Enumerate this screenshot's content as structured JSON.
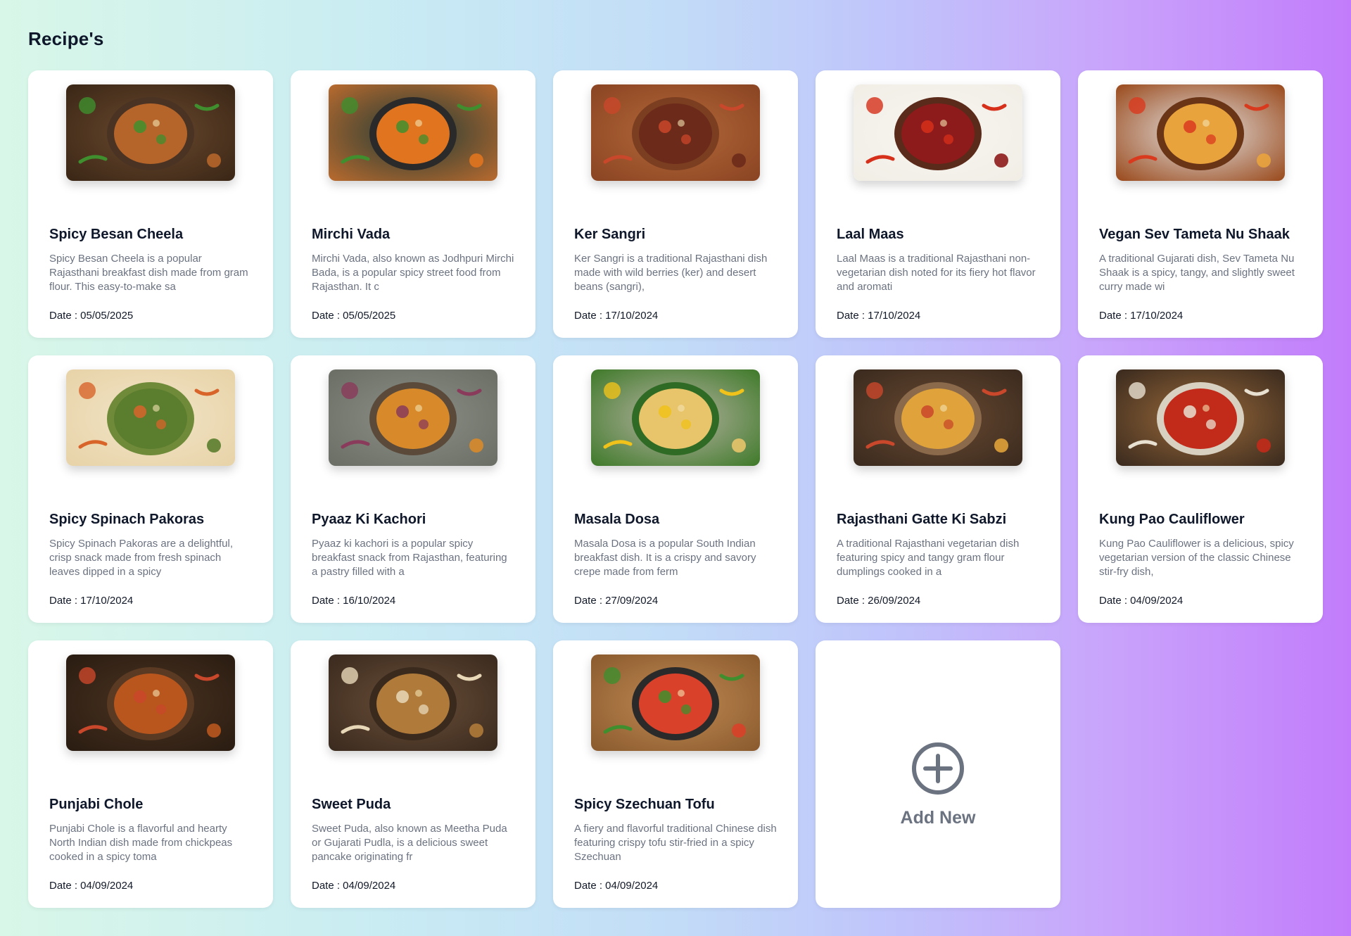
{
  "page": {
    "title": "Recipe's"
  },
  "recipes": [
    {
      "title": "Spicy Besan Cheela",
      "description": "Spicy Besan Cheela is a popular Rajasthani breakfast dish made from gram flour. This easy-to-make sa",
      "date": "Date : 05/05/2025",
      "image": "besan-cheela-photo"
    },
    {
      "title": "Mirchi Vada",
      "description": "Mirchi Vada, also known as Jodhpuri Mirchi Bada, is a popular spicy street food from Rajasthan. It c",
      "date": "Date : 05/05/2025",
      "image": "mirchi-vada-photo"
    },
    {
      "title": "Ker Sangri",
      "description": "Ker Sangri is a traditional Rajasthani dish made with wild berries (ker) and desert beans (sangri),",
      "date": "Date : 17/10/2024",
      "image": "ker-sangri-photo"
    },
    {
      "title": "Laal Maas",
      "description": "Laal Maas is a traditional Rajasthani non-vegetarian dish noted for its fiery hot flavor and aromati",
      "date": "Date : 17/10/2024",
      "image": "laal-maas-photo"
    },
    {
      "title": "Vegan Sev Tameta Nu Shaak",
      "description": "A traditional Gujarati dish, Sev Tameta Nu Shaak is a spicy, tangy, and slightly sweet curry made wi",
      "date": "Date : 17/10/2024",
      "image": "sev-tameta-photo"
    },
    {
      "title": "Spicy Spinach Pakoras",
      "description": "Spicy Spinach Pakoras are a delightful, crisp snack made from fresh spinach leaves dipped in a spicy",
      "date": "Date : 17/10/2024",
      "image": "spinach-pakoras-photo"
    },
    {
      "title": "Pyaaz Ki Kachori",
      "description": "Pyaaz ki kachori is a popular spicy breakfast snack from Rajasthan, featuring a pastry filled with a",
      "date": "Date : 16/10/2024",
      "image": "pyaaz-kachori-photo"
    },
    {
      "title": "Masala Dosa",
      "description": "Masala Dosa is a popular South Indian breakfast dish. It is a crispy and savory crepe made from ferm",
      "date": "Date : 27/09/2024",
      "image": "masala-dosa-photo"
    },
    {
      "title": "Rajasthani Gatte Ki Sabzi",
      "description": "A traditional Rajasthani vegetarian dish featuring spicy and tangy gram flour dumplings cooked in a",
      "date": "Date : 26/09/2024",
      "image": "gatte-sabzi-photo"
    },
    {
      "title": "Kung Pao Cauliflower",
      "description": "Kung Pao Cauliflower is a delicious, spicy vegetarian version of the classic Chinese stir-fry dish,",
      "date": "Date : 04/09/2024",
      "image": "kung-pao-photo"
    },
    {
      "title": "Punjabi Chole",
      "description": "Punjabi Chole is a flavorful and hearty North Indian dish made from chickpeas cooked in a spicy toma",
      "date": "Date : 04/09/2024",
      "image": "punjabi-chole-photo"
    },
    {
      "title": "Sweet Puda",
      "description": "Sweet Puda, also known as Meetha Puda or Gujarati Pudla, is a delicious sweet pancake originating fr",
      "date": "Date : 04/09/2024",
      "image": "sweet-puda-photo"
    },
    {
      "title": "Spicy Szechuan Tofu",
      "description": "A fiery and flavorful traditional Chinese dish featuring crispy tofu stir-fried in a spicy Szechuan",
      "date": "Date : 04/09/2024",
      "image": "szechuan-tofu-photo"
    }
  ],
  "add_new": {
    "label": "Add New",
    "icon": "plus-circle-icon"
  },
  "thumb_palettes": [
    {
      "bg": "#6b4a2e",
      "bg2": "#3a2616",
      "dish": "#b5652a",
      "accent": "#3f8f2e",
      "rim": "#4a3323"
    },
    {
      "bg": "#1f3b36",
      "bg2": "#b86a2e",
      "dish": "#e0741f",
      "accent": "#3f8f2e",
      "rim": "#2a2a2a"
    },
    {
      "bg": "#b4693a",
      "bg2": "#8a4422",
      "dish": "#6b2a1a",
      "accent": "#c9472a",
      "rim": "#7b3e20"
    },
    {
      "bg": "#f7f5ef",
      "bg2": "#f1eee6",
      "dish": "#8e1b1b",
      "accent": "#d62f1a",
      "rim": "#5a2a1a"
    },
    {
      "bg": "#e4e4e4",
      "bg2": "#9a4a1c",
      "dish": "#e9a33d",
      "accent": "#d93a1e",
      "rim": "#6a3416"
    },
    {
      "bg": "#f1e4c6",
      "bg2": "#e8d3a8",
      "dish": "#5b7d2e",
      "accent": "#d8642a",
      "rim": "#6f8b3a"
    },
    {
      "bg": "#8b8f86",
      "bg2": "#6a6e65",
      "dish": "#d88a2a",
      "accent": "#8a3a5a",
      "rim": "#5b4a3a"
    },
    {
      "bg": "#b9b3a5",
      "bg2": "#3f7a2a",
      "dish": "#e8c46a",
      "accent": "#f0c21a",
      "rim": "#2f6b24"
    },
    {
      "bg": "#6a4a32",
      "bg2": "#3a2a1e",
      "dish": "#e0a23a",
      "accent": "#c9472a",
      "rim": "#8a6a4a"
    },
    {
      "bg": "#9a6a3a",
      "bg2": "#3a2a1e",
      "dish": "#c22a1a",
      "accent": "#e8e0d0",
      "rim": "#d8d0c0"
    },
    {
      "bg": "#4a3320",
      "bg2": "#2a1c12",
      "dish": "#b8561e",
      "accent": "#c9472a",
      "rim": "#5a3a22"
    },
    {
      "bg": "#6a4e38",
      "bg2": "#3a2a1e",
      "dish": "#b07a3a",
      "accent": "#e8d8b8",
      "rim": "#3a2a1e"
    },
    {
      "bg": "#c08a52",
      "bg2": "#8a5a2e",
      "dish": "#d9412a",
      "accent": "#3f8f2e",
      "rim": "#2a2a2a"
    }
  ]
}
